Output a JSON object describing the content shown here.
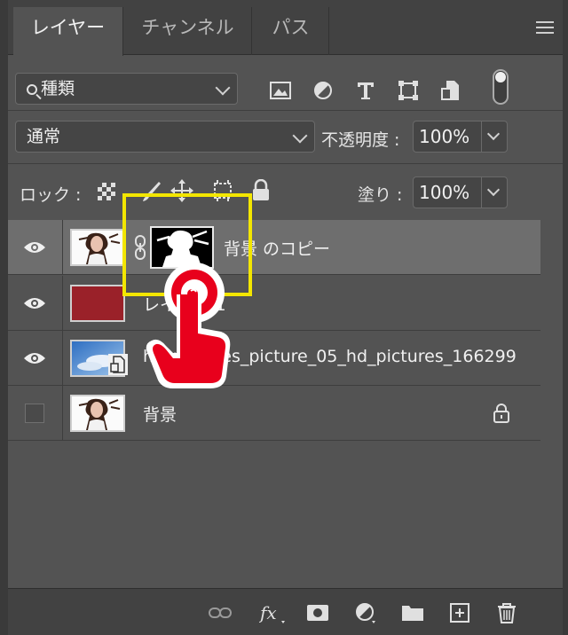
{
  "tabs": [
    {
      "label": "レイヤー",
      "active": true
    },
    {
      "label": "チャンネル",
      "active": false
    },
    {
      "label": "パス",
      "active": false
    }
  ],
  "filter": {
    "kind_label": "種類"
  },
  "blend": {
    "mode": "通常",
    "opacity_label": "不透明度 :",
    "opacity_value": "100%"
  },
  "lock": {
    "label": "ロック :",
    "fill_label": "塗り :",
    "fill_value": "100%"
  },
  "layers": [
    {
      "name": "背景 のコピー",
      "visible": true,
      "selected": true
    },
    {
      "name": "レイヤー 1",
      "visible": true,
      "selected": false,
      "fill_color": "#9a2129"
    },
    {
      "name": "hd_pictures_picture_05_hd_pictures_166299",
      "visible": true,
      "selected": false
    },
    {
      "name": "背景",
      "visible": false,
      "selected": false,
      "locked": true
    }
  ],
  "colors": {
    "highlight": "#f3e600",
    "hand": "#e8001c"
  }
}
